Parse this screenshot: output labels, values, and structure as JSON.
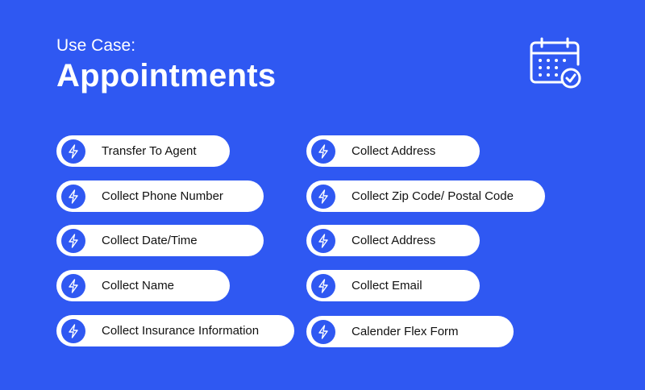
{
  "header": {
    "eyebrow": "Use Case:",
    "title": "Appointments",
    "icon": "calendar-check-icon"
  },
  "colors": {
    "background": "#2f58f2",
    "pill": "#ffffff",
    "badge": "#2f58f2",
    "text": "#111111"
  },
  "left_items": [
    {
      "label": "Transfer To Agent",
      "icon": "lightning-icon"
    },
    {
      "label": "Collect Phone Number",
      "icon": "lightning-icon"
    },
    {
      "label": "Collect Date/Time",
      "icon": "lightning-icon"
    },
    {
      "label": "Collect Name",
      "icon": "lightning-icon"
    },
    {
      "label": "Collect Insurance Information",
      "icon": "lightning-icon"
    }
  ],
  "right_items": [
    {
      "label": "Collect Address",
      "icon": "lightning-icon"
    },
    {
      "label": "Collect Zip Code/ Postal Code",
      "icon": "lightning-icon"
    },
    {
      "label": "Collect Address",
      "icon": "lightning-icon"
    },
    {
      "label": "Collect Email",
      "icon": "lightning-icon"
    },
    {
      "label": "Calender Flex Form",
      "icon": "lightning-icon"
    }
  ]
}
